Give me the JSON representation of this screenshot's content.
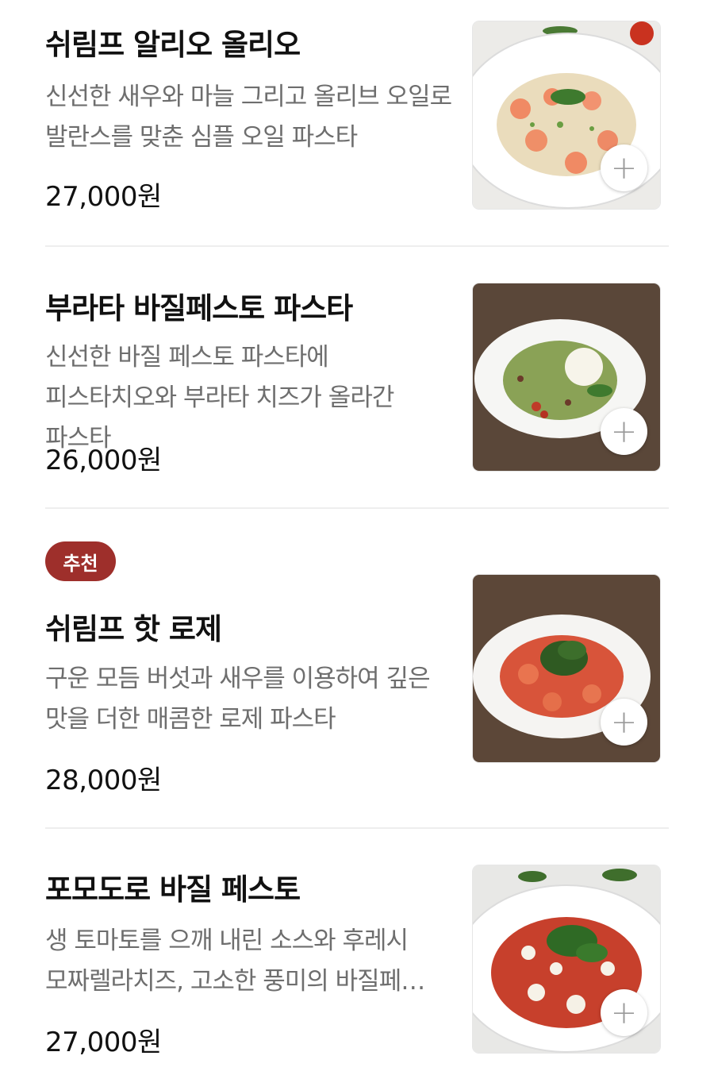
{
  "menu": {
    "items": [
      {
        "name": "쉬림프 알리오 올리오",
        "description": "신선한 새우와 마늘 그리고 올리브 오일로 발란스를 맞춘 심플 오일 파스타",
        "price": "27,000원",
        "badge": "",
        "photo": "shrimp-aglio-olio-photo"
      },
      {
        "name": "부라타 바질페스토 파스타",
        "description": "신선한 바질 페스토 파스타에 피스타치오와 부라타 치즈가 올라간 파스타",
        "price": "26,000원",
        "badge": "",
        "photo": "burrata-basil-pesto-photo"
      },
      {
        "name": "쉬림프 핫 로제",
        "description": "구운 모듬 버섯과 새우를 이용하여 깊은 맛을 더한 매콤한 로제 파스타",
        "price": "28,000원",
        "badge": "추천",
        "photo": "shrimp-hot-rose-photo"
      },
      {
        "name": "포모도로 바질 페스토",
        "description": "생 토마토를 으깨 내린 소스와 후레시 모짜렐라치즈, 고소한 풍미의 바질페…",
        "price": "27,000원",
        "badge": "",
        "photo": "pomodoro-basil-pesto-photo"
      }
    ],
    "add_button_symbol": "+",
    "colors": {
      "badge": "#9e2f2b",
      "description": "#6e6e6e",
      "divider": "#eeeeee"
    }
  }
}
